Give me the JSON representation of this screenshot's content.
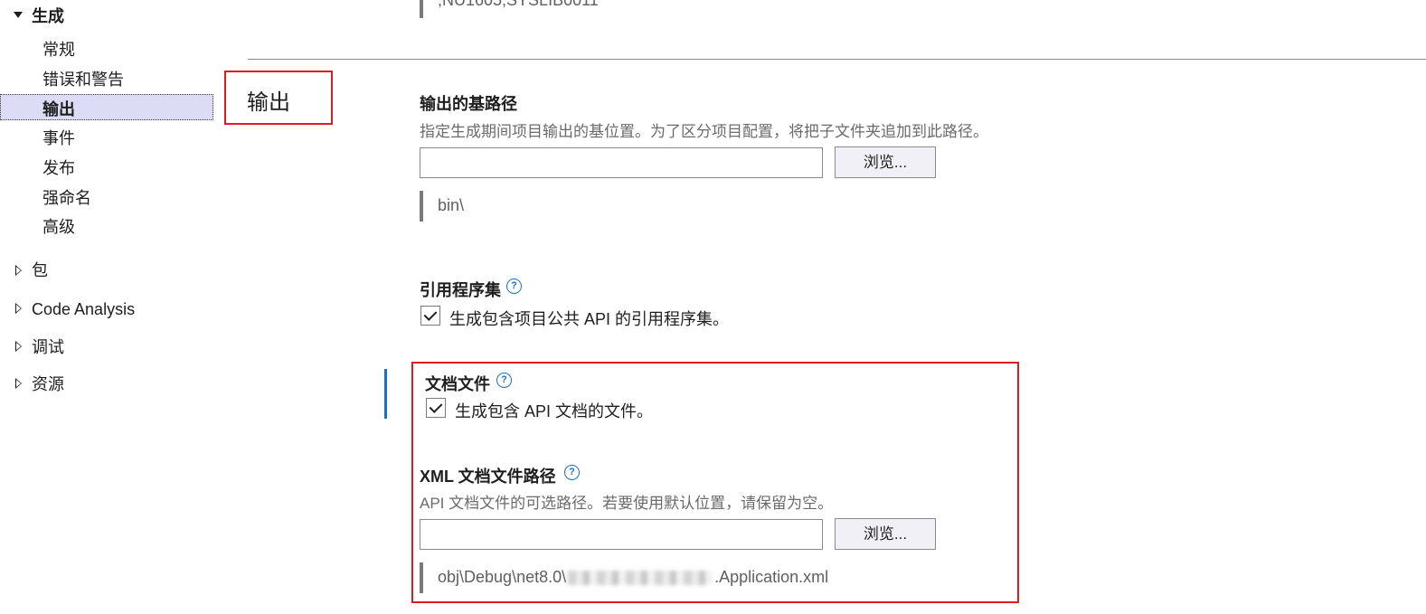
{
  "sidebar": {
    "section_build": "生成",
    "items": [
      "常规",
      "错误和警告",
      "输出",
      "事件",
      "发布",
      "强命名",
      "高级"
    ],
    "selected": "输出",
    "groups": [
      "包",
      "Code Analysis",
      "调试",
      "资源"
    ]
  },
  "top_value": ";NU1605;SYSLIB0011",
  "page_title": "输出",
  "base_path": {
    "heading": "输出的基路径",
    "description": "指定生成期间项目输出的基位置。为了区分项目配置，将把子文件夹追加到此路径。",
    "input_value": "",
    "browse_label": "浏览...",
    "resolved_value": "bin\\"
  },
  "reference_assembly": {
    "heading": "引用程序集",
    "help_icon": "?",
    "checkbox_label": "生成包含项目公共 API 的引用程序集。",
    "checked": true
  },
  "doc_file": {
    "heading": "文档文件",
    "help_icon": "?",
    "checkbox_label": "生成包含 API 文档的文件。",
    "checked": true
  },
  "xml_doc_path": {
    "heading": "XML 文档文件路径",
    "help_icon": "?",
    "description": "API 文档文件的可选路径。若要使用默认位置，请保留为空。",
    "input_value": "",
    "browse_label": "浏览...",
    "resolved_prefix": "obj\\Debug\\net8.0\\",
    "resolved_suffix": ".Application.xml"
  },
  "colors": {
    "highlight_red": "#e01b24",
    "accent_blue": "#1a6fc4",
    "selected_bg": "#dcdcf7"
  }
}
